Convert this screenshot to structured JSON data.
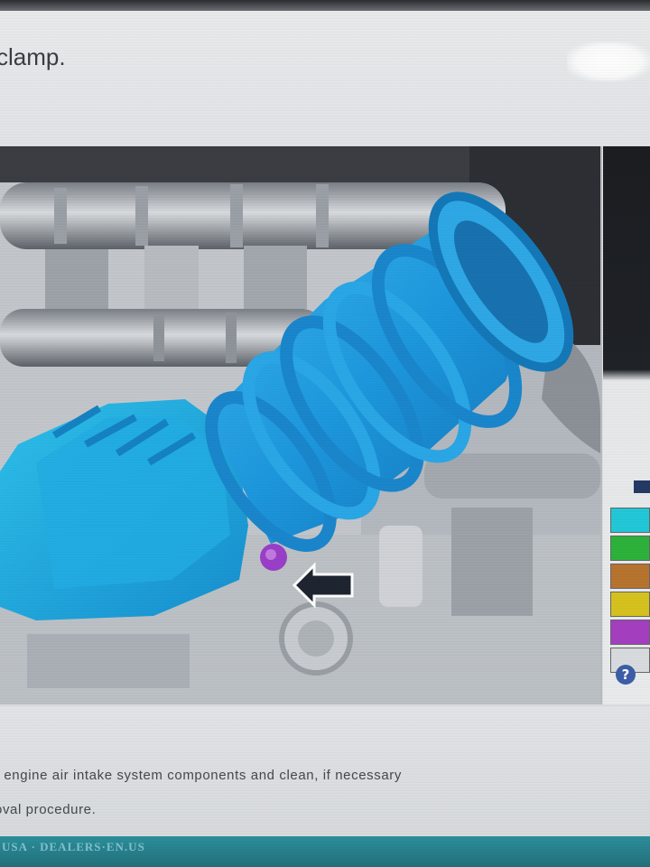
{
  "header": {
    "title": "clamp."
  },
  "diagram": {
    "description_colors": {
      "component": "#1f9ee0",
      "component_shadow": "#1478b8",
      "clip": "#9a3fc8",
      "arrow": "#1e2530",
      "engine": "#b9bec4"
    }
  },
  "legend": {
    "swatches": [
      {
        "color": "#22c8d8"
      },
      {
        "color": "#2db33b"
      },
      {
        "color": "#b7742f"
      },
      {
        "color": "#d6c21e"
      },
      {
        "color": "#a53fc0"
      },
      {
        "color": "#d9dcdf"
      }
    ]
  },
  "help": {
    "label": "?"
  },
  "content": {
    "line1": "r engine air intake system components and clean, if necessary",
    "line2": "oval procedure."
  },
  "footer": {
    "text": "USA · DEALERS·EN.US"
  }
}
